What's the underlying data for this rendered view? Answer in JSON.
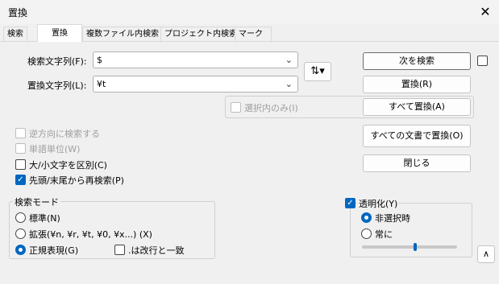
{
  "window": {
    "title": "置換",
    "close_glyph": "✕"
  },
  "tabs": [
    {
      "label": "検索"
    },
    {
      "label": "置換"
    },
    {
      "label": "複数ファイル内検索"
    },
    {
      "label": "プロジェクト内検索"
    },
    {
      "label": "マーク"
    }
  ],
  "find": {
    "label": "検索文字列(F):",
    "value": "$"
  },
  "replace": {
    "label": "置換文字列(L):",
    "value": "¥t"
  },
  "swap_glyph": "⇅",
  "buttons": {
    "find_next": "次を検索",
    "replace": "置換(R)",
    "replace_all": "すべて置換(A)",
    "replace_all_docs": "すべての文書で置換(O)",
    "close": "閉じる"
  },
  "in_selection": {
    "label": "選択内のみ(I)"
  },
  "options": {
    "backward": "逆方向に検索する",
    "whole_word": "単語単位(W)",
    "match_case": "大/小文字を区別(C)",
    "wrap": "先頭/末尾から再検索(P)"
  },
  "search_mode": {
    "title": "検索モード",
    "normal": "標準(N)",
    "extended": "拡張(¥n, ¥r, ¥t, ¥0, ¥x...) (X)",
    "regex": "正規表現(G)",
    "dot_newline": ".は改行と一致"
  },
  "transparency": {
    "title": "透明化(Y)",
    "on_lose_focus": "非選択時",
    "always": "常に",
    "level": 0.56
  },
  "expand_glyph": "∧"
}
